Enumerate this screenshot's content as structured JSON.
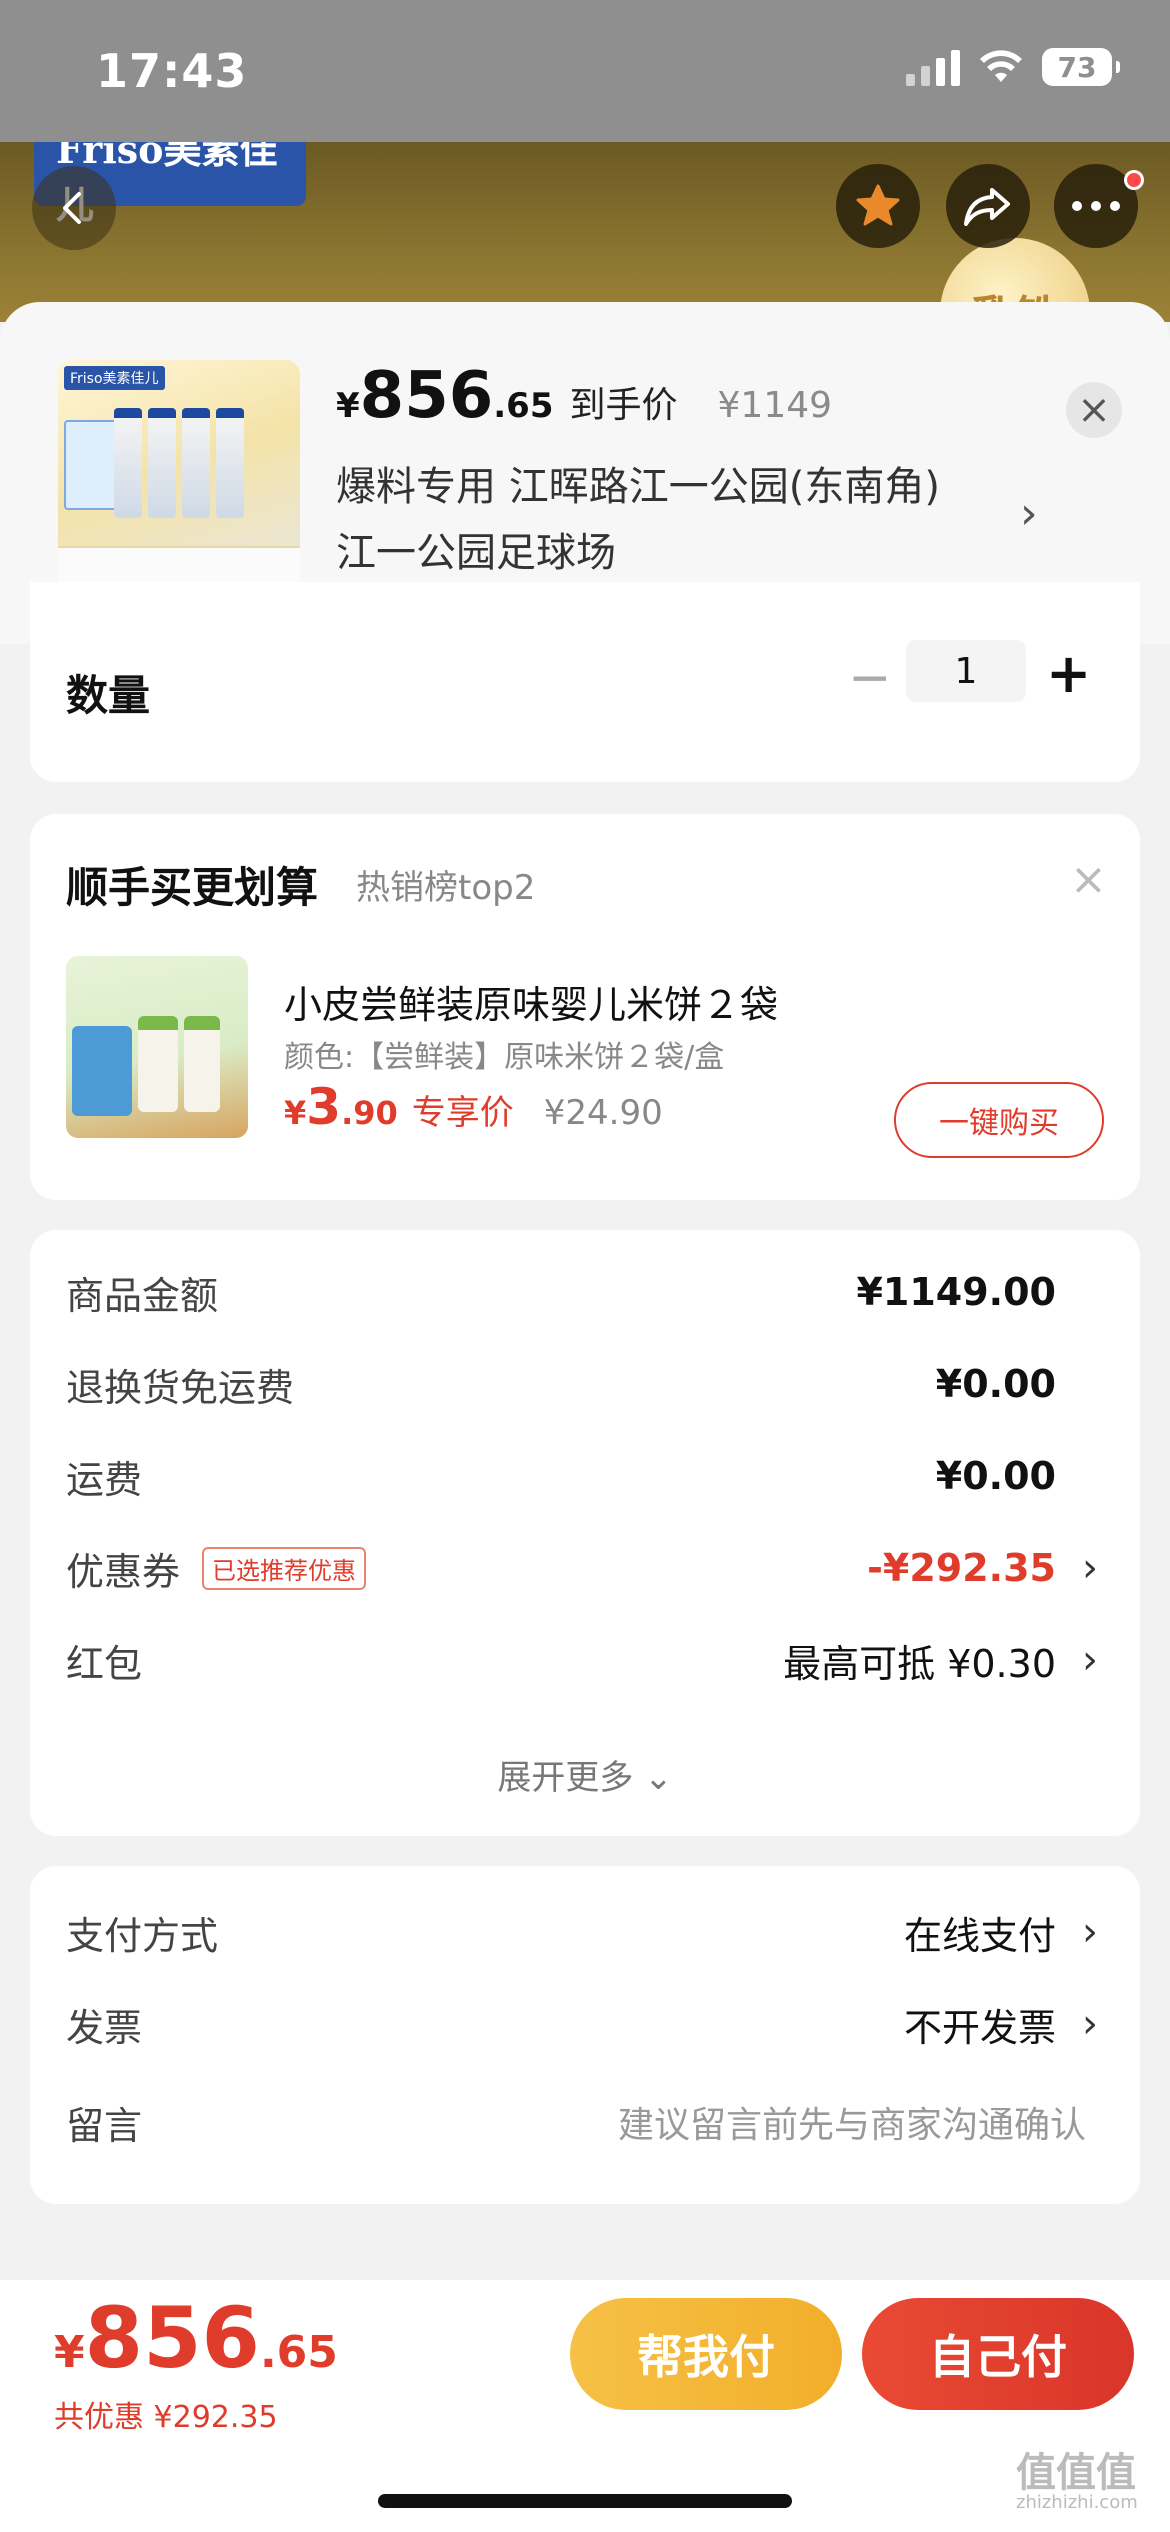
{
  "status": {
    "time": "17:43",
    "battery": "73"
  },
  "hero": {
    "brand": "Friso美素佳儿",
    "badge": "乳铁"
  },
  "product": {
    "price_symbol": "¥",
    "price_int": "856",
    "price_dec": ".65",
    "price_label": "到手价",
    "original_price": "¥1149",
    "address_line1": "爆料专用  江晖路江一公园(东南角)",
    "address_line2": "江一公园足球场",
    "thumb_brand": "Friso美素佳儿"
  },
  "quantity": {
    "label": "数量",
    "value": "1"
  },
  "upsell": {
    "title": "顺手买更划算",
    "subtitle": "热销榜top2",
    "name": "小皮尝鲜装原味婴儿米饼２袋",
    "spec": "颜色:【尝鲜装】原味米饼２袋/盒",
    "price_symbol": "¥",
    "price_int": "3",
    "price_dec": ".90",
    "price_label": "专享价",
    "original_price": "¥24.90",
    "buy_label": "一键购买"
  },
  "summary": {
    "rows": [
      {
        "label": "商品金额",
        "value": "¥1149.00"
      },
      {
        "label": "退换货免运费",
        "value": "¥0.00"
      },
      {
        "label": "运费",
        "value": "¥0.00"
      },
      {
        "label": "优惠券",
        "badge": "已选推荐优惠",
        "value": "-¥292.35"
      },
      {
        "label": "红包",
        "value": "最高可抵 ¥0.30"
      }
    ],
    "expand_label": "展开更多 ⌄"
  },
  "payment": {
    "rows": [
      {
        "label": "支付方式",
        "value": "在线支付"
      },
      {
        "label": "发票",
        "value": "不开发票"
      },
      {
        "label": "留言",
        "value": "建议留言前先与商家沟通确认"
      }
    ]
  },
  "footer": {
    "total_symbol": "¥",
    "total_int": "856",
    "total_dec": ".65",
    "discount": "共优惠 ¥292.35",
    "help_pay": "帮我付",
    "self_pay": "自己付",
    "watermark": "值值值",
    "watermark_sub": "zhizhizhi.com"
  },
  "colors": {
    "accent": "#e03c2c",
    "help_button": "#f2ae2a",
    "self_button": "#d9352a"
  },
  "icons": [
    "back-icon",
    "star-icon",
    "share-icon",
    "more-icon",
    "close-icon",
    "chevron-right-icon",
    "minus-icon",
    "plus-icon"
  ]
}
